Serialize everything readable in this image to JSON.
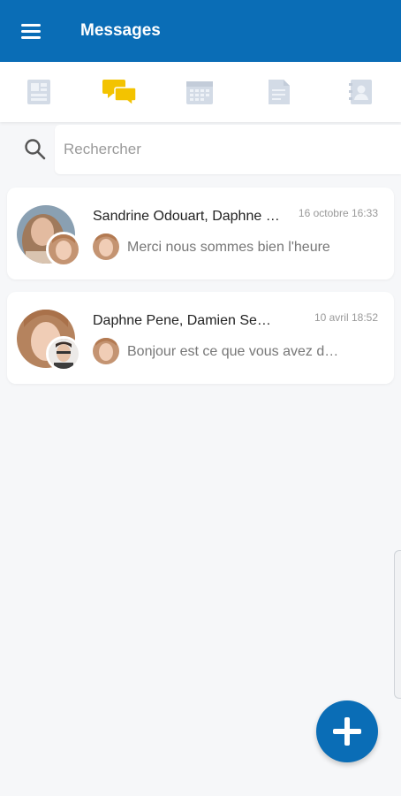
{
  "app": {
    "title": "Messages"
  },
  "colors": {
    "brand": "#0a6db6",
    "accent_yellow": "#f3c300",
    "tab_inactive": "#d3dbe6"
  },
  "tabs": [
    {
      "icon": "dashboard-icon",
      "active": false
    },
    {
      "icon": "chat-bubbles-icon",
      "active": true
    },
    {
      "icon": "calendar-icon",
      "active": false
    },
    {
      "icon": "document-icon",
      "active": false
    },
    {
      "icon": "contacts-icon",
      "active": false
    }
  ],
  "search": {
    "placeholder": "Rechercher"
  },
  "conversations": [
    {
      "participants": "Sandrine Odouart, Daphne Pene",
      "time": "16 octobre 16:33",
      "preview": "Merci nous sommes bien l'heure"
    },
    {
      "participants": "Daphne Pene, Damien Sembach",
      "time": "10 avril 18:52",
      "preview": "Bonjour est ce que vous avez des nouvelles"
    }
  ],
  "fab": {
    "icon": "plus-icon"
  }
}
